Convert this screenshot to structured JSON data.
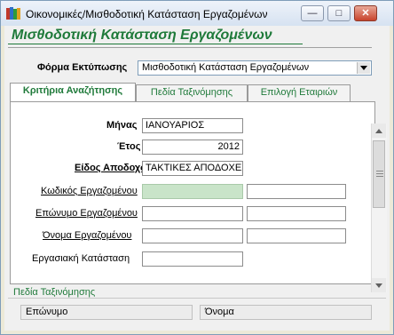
{
  "window": {
    "title": "Οικονομικές/Μισθοδοτική Κατάσταση Εργαζομένων",
    "minimize_glyph": "—",
    "maximize_glyph": "□",
    "close_glyph": "✕"
  },
  "header": {
    "title": "Μισθοδοτική Κατάσταση Εργαζομένων"
  },
  "print_form": {
    "label": "Φόρμα Εκτύπωσης",
    "value": "Μισθοδοτική Κατάσταση Εργαζομένων"
  },
  "tabs": [
    {
      "label": "Κριτήρια Αναζήτησης",
      "active": true
    },
    {
      "label": "Πεδία Ταξινόμησης",
      "active": false
    },
    {
      "label": "Επιλογή Εταιριών",
      "active": false
    }
  ],
  "criteria": {
    "month": {
      "label": "Μήνας",
      "value": "ΙΑΝΟΥΑΡΙΟΣ"
    },
    "year": {
      "label": "Έτος",
      "value": "2012"
    },
    "pay_type": {
      "label": "Είδος Αποδοχών",
      "value": "ΤΑΚΤΙΚΕΣ ΑΠΟΔΟΧΕΣ"
    },
    "employee_code": {
      "label": "Κωδικός Εργαζομένου",
      "from": "",
      "to": ""
    },
    "employee_surname": {
      "label": "Επώνυμο Εργαζομένου",
      "from": "",
      "to": ""
    },
    "employee_name": {
      "label": "Όνομα Εργαζομένου",
      "from": "",
      "to": ""
    },
    "work_status": {
      "label": "Εργασιακή Κατάσταση",
      "value": ""
    }
  },
  "sort_fields": {
    "title": "Πεδία Ταξινόμησης",
    "field1": "Επώνυμο",
    "field2": "Όνομα"
  },
  "colors": {
    "accent_green": "#1f7a3a",
    "highlight_field": "#c9e4c9"
  }
}
